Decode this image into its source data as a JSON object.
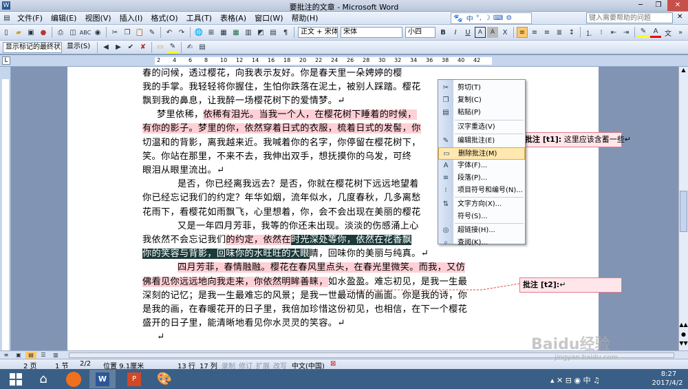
{
  "window": {
    "title": "要批注的文章 - Microsoft Word"
  },
  "menu": [
    "文件(F)",
    "编辑(E)",
    "视图(V)",
    "插入(I)",
    "格式(O)",
    "工具(T)",
    "表格(A)",
    "窗口(W)",
    "帮助(H)"
  ],
  "help": {
    "placeholder": "键入需要帮助的问题"
  },
  "toolbar": {
    "style": "正文 + 宋体",
    "font": "宋体",
    "size": "小四"
  },
  "toolbar2": {
    "markup_view": "显示标记的最终状态",
    "show": "显示(S)"
  },
  "ruler": {
    "marks": [
      "2",
      "4",
      "6",
      "8",
      "10",
      "12",
      "14",
      "16",
      "18",
      "20",
      "22",
      "24",
      "26",
      "28",
      "30",
      "32",
      "34",
      "36",
      "38",
      "40",
      "42"
    ]
  },
  "document": {
    "lines": [
      {
        "plain_a": "春的问候，透过樱花，向我表示友好。你是春天里一朵娉婷的樱",
        "hl": "",
        "sel": "",
        "plain_b": ""
      },
      {
        "plain_a": "我的手掌。我轻轻将你握住，生怕你跌落在泥土，被别人踩踏。樱花",
        "hl": "",
        "sel": "",
        "plain_b": ""
      },
      {
        "plain_a": "飘到我的鼻息，让我醉一场樱花树下的爱情梦。↵",
        "hl": "",
        "sel": "",
        "plain_b": ""
      },
      {
        "plain_a": "梦里依稀，",
        "hl": "依稀有泪光。当我一个人，在樱花树下睡着的时候，",
        "sel": "",
        "plain_b": ""
      },
      {
        "plain_a": "",
        "hl": "有你的影子。梦里的你，依然穿着日式的衣服，梳着日式的发髻，你",
        "sel": "",
        "plain_b": ""
      },
      {
        "plain_a": "切温和的背影，离我越来近。我喊着你的名字，你停留在樱花树下，",
        "hl": "",
        "sel": "",
        "plain_b": ""
      },
      {
        "plain_a": "笑。你站在那里，不来不去，我伸出双手，想抚摸你的乌发，可终",
        "hl": "",
        "sel": "",
        "plain_b": ""
      },
      {
        "plain_a": "眼泪从眼里流出。↵",
        "hl": "",
        "sel": "",
        "plain_b": ""
      },
      {
        "plain_a": "是否，你已经离我远去？是否，你就在樱花树下远远地望着",
        "hl": "",
        "sel": "",
        "plain_b": ""
      },
      {
        "plain_a": "你已经忘记我们的约定？年华如烟，流年似水，几度春秋，几多离愁",
        "hl": "",
        "sel": "",
        "plain_b": ""
      },
      {
        "plain_a": "花雨下，看樱花如雨飘飞，心里想着，你，会不会出现在美丽的樱花",
        "hl": "",
        "sel": "",
        "plain_b": ""
      },
      {
        "plain_a": "又是一年四月芳菲，我等的你还未出现。淡淡的伤感涌上心",
        "hl": "",
        "sel": "",
        "plain_b": ""
      },
      {
        "plain_a": "我依然不会忘记我们",
        "hl": "的约定，依然在",
        "sel": "时光深处等你，依然在花香飘",
        "plain_b": ""
      },
      {
        "plain_a": "",
        "hl": "",
        "sel": "你的笑容与背影，回味你的水旺旺的大眼",
        "plain_b": "睛，回味你的美丽与纯真。↵"
      },
      {
        "plain_a": "",
        "hl": "四月芳菲，春情融融。樱花在春风里点头，在春光里微笑。而我，又仿",
        "sel": "",
        "plain_b": ""
      },
      {
        "plain_a": "",
        "hl": "佛看见你远远地向我走来，你依然明眸善睐，",
        "sel": "",
        "plain_b": "如水盈盈。难忘初见，是我一生最"
      },
      {
        "plain_a": "深刻的记忆；是我一生最难忘的风景；是我一世最动情的画面。你是我的诗，你",
        "hl": "",
        "sel": "",
        "plain_b": ""
      },
      {
        "plain_a": "是我的画，在春暖花开的日子里，我倍加珍惜这份初见，也相信，在下一个樱花",
        "hl": "",
        "sel": "",
        "plain_b": ""
      },
      {
        "plain_a": "盛开的日子里，能清晰地看见你水灵灵的笑容。↵",
        "hl": "",
        "sel": "",
        "plain_b": ""
      },
      {
        "plain_a": "↵",
        "hl": "",
        "sel": "",
        "plain_b": ""
      }
    ]
  },
  "comments": [
    {
      "label": "批注 [t1]:",
      "text": " 这里应该含蓄一些↵"
    },
    {
      "label": "批注 [t2]:",
      "text": "↵"
    }
  ],
  "context_menu": {
    "items": [
      {
        "label": "剪切(T)",
        "icon": "cut-icon"
      },
      {
        "label": "复制(C)",
        "icon": "copy-icon"
      },
      {
        "label": "粘贴(P)",
        "icon": "paste-icon"
      },
      {
        "label": "汉字重选(V)",
        "icon": ""
      },
      {
        "label": "编辑批注(E)",
        "icon": "edit-comment-icon"
      },
      {
        "label": "删除批注(M)",
        "icon": "delete-comment-icon"
      },
      {
        "label": "字体(F)...",
        "icon": "font-icon"
      },
      {
        "label": "段落(P)...",
        "icon": "paragraph-icon"
      },
      {
        "label": "项目符号和编号(N)...",
        "icon": "bullets-icon"
      },
      {
        "label": "文字方向(X)...",
        "icon": "text-direction-icon"
      },
      {
        "label": "符号(S)...",
        "icon": ""
      },
      {
        "label": "超链接(H)...",
        "icon": "hyperlink-icon"
      },
      {
        "label": "查阅(K)...",
        "icon": "lookup-icon"
      }
    ],
    "highlighted": "删除批注(M)"
  },
  "status": {
    "page": "2 页",
    "section": "1 节",
    "pages": "2/2",
    "position": "位置 9.1厘米",
    "line": "13 行",
    "column": "17 列",
    "rec": "录制",
    "trk": "修订",
    "ext": "扩展",
    "ovr": "改写",
    "lang": "中文(中国)"
  },
  "watermark": {
    "brand": "Baidu经验",
    "url": "jingyan.baidu.com"
  },
  "taskbar": {
    "time": "8:27",
    "date": "2017/4/2"
  },
  "colors": {
    "comment_fill": "#ffe6ea",
    "comment_border": "#e07a88",
    "highlight": "#ffd0d6",
    "selection": "#1c3a3a",
    "menu_hover": "#ffe8b0"
  }
}
